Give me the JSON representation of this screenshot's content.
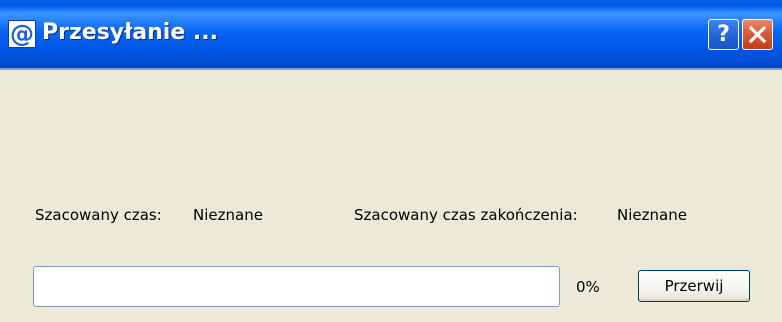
{
  "window": {
    "title": "Przesyłanie ...",
    "icon": "internet-explorer-icon",
    "help_label": "?",
    "close_icon": "close-icon"
  },
  "status": {
    "estimated_time_label": "Szacowany czas:",
    "estimated_time_value": "Nieznane",
    "estimated_end_label": "Szacowany czas zakończenia:",
    "estimated_end_value": "Nieznane"
  },
  "progress": {
    "percent_text": "0%",
    "fraction": 0
  },
  "actions": {
    "abort_label": "Przerwij"
  },
  "colors": {
    "titlebar": "#0054e3",
    "dialog_background": "#ece9d8",
    "close_button": "#d95a35"
  }
}
